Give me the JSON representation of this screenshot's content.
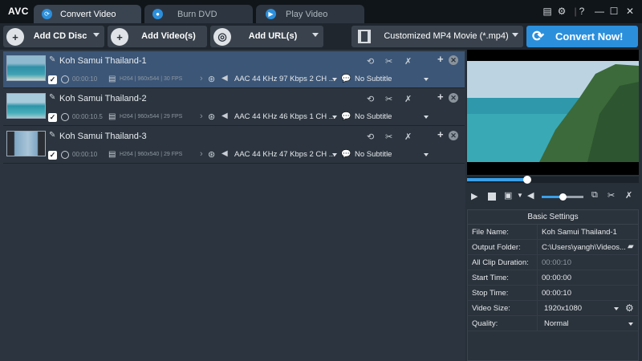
{
  "app": {
    "logo": "AVC"
  },
  "tabs": [
    {
      "label": "Convert Video",
      "icon": "convert-icon",
      "active": true
    },
    {
      "label": "Burn DVD",
      "icon": "disc-icon",
      "active": false
    },
    {
      "label": "Play Video",
      "icon": "play-icon",
      "active": false
    }
  ],
  "toolbar": {
    "add_cd": "Add CD Disc",
    "add_video": "Add Video(s)",
    "add_url": "Add URL(s)",
    "profile": "Customized MP4 Movie (*.mp4)",
    "convert": "Convert Now!"
  },
  "files": [
    {
      "name": "Koh Samui Thailand-1",
      "duration": "00:00:10",
      "vinfo": "H264 | 960x544 | 30 FPS",
      "audio": "AAC 44 KHz 97 Kbps 2 CH ...",
      "subtitle": "No Subtitle",
      "checked": true,
      "selected": true
    },
    {
      "name": "Koh Samui Thailand-2",
      "duration": "00:00:10.5",
      "vinfo": "H264 | 960x544 | 29 FPS",
      "audio": "AAC 44 KHz 46 Kbps 1 CH ...",
      "subtitle": "No Subtitle",
      "checked": true,
      "selected": false
    },
    {
      "name": "Koh Samui Thailand-3",
      "duration": "00:00:10",
      "vinfo": "H264 | 960x540 | 29 FPS",
      "audio": "AAC 44 KHz 47 Kbps 2 CH ...",
      "subtitle": "No Subtitle",
      "checked": true,
      "selected": false
    }
  ],
  "player": {
    "progress": 0.35,
    "volume": 0.5
  },
  "settings": {
    "title": "Basic Settings",
    "file_name_label": "File Name:",
    "file_name": "Koh Samui Thailand-1",
    "output_folder_label": "Output Folder:",
    "output_folder": "C:\\Users\\yangh\\Videos...",
    "all_clip_duration_label": "All Clip Duration:",
    "all_clip_duration": "00:00:10",
    "start_time_label": "Start Time:",
    "start_time": "00:00:00",
    "stop_time_label": "Stop Time:",
    "stop_time": "00:00:10",
    "video_size_label": "Video Size:",
    "video_size": "1920x1080",
    "quality_label": "Quality:",
    "quality": "Normal"
  },
  "colors": {
    "accent": "#2b8fdc",
    "selected_row": "#3c5677"
  }
}
